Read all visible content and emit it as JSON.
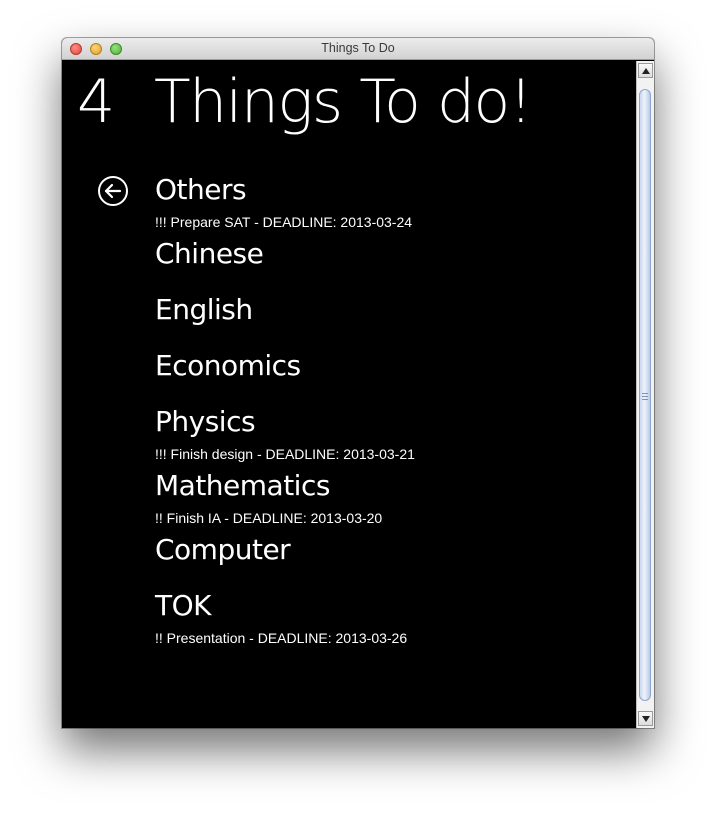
{
  "window": {
    "title": "Things To Do"
  },
  "header": {
    "count": "4",
    "title": "Things To do!"
  },
  "categories": [
    {
      "name": "Others",
      "task": "!!! Prepare SAT - DEADLINE: 2013-03-24"
    },
    {
      "name": "Chinese",
      "task": ""
    },
    {
      "name": "English",
      "task": ""
    },
    {
      "name": "Economics",
      "task": ""
    },
    {
      "name": "Physics",
      "task": "!!! Finish design - DEADLINE: 2013-03-21"
    },
    {
      "name": "Mathematics",
      "task": "!!  Finish IA - DEADLINE: 2013-03-20"
    },
    {
      "name": "Computer",
      "task": ""
    },
    {
      "name": "TOK",
      "task": "!!  Presentation - DEADLINE: 2013-03-26"
    }
  ],
  "icons": {
    "back": "back-arrow-circle-icon",
    "close": "close-traffic-light",
    "minimize": "minimize-traffic-light",
    "zoom": "zoom-traffic-light",
    "scroll_up": "arrow-up-icon",
    "scroll_down": "arrow-down-icon"
  },
  "colors": {
    "background": "#000000",
    "text": "#ffffff",
    "close": "#e0443e",
    "minimize": "#dea123",
    "zoom": "#4fae33"
  }
}
